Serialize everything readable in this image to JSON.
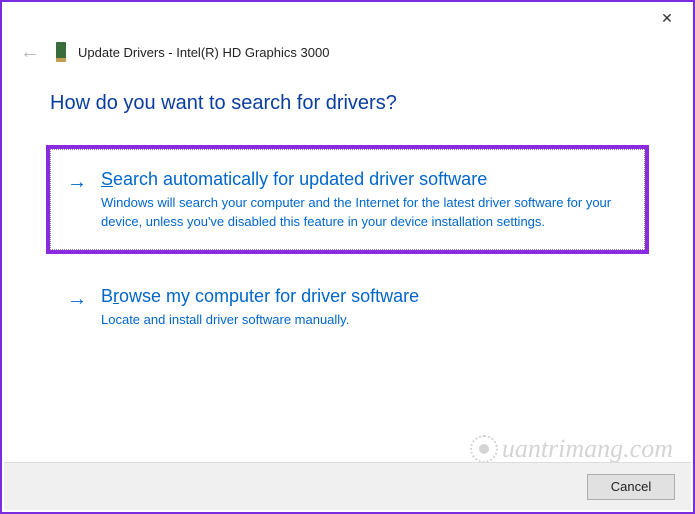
{
  "window": {
    "title": "Update Drivers - Intel(R) HD Graphics 3000"
  },
  "question": "How do you want to search for drivers?",
  "options": {
    "auto": {
      "title_prefix": "S",
      "title_rest": "earch automatically for updated driver software",
      "desc": "Windows will search your computer and the Internet for the latest driver software for your device, unless you've disabled this feature in your device installation settings."
    },
    "browse": {
      "title_prefix": "B",
      "title_underline": "r",
      "title_rest": "owse my computer for driver software",
      "desc": "Locate and install driver software manually."
    }
  },
  "buttons": {
    "cancel": "Cancel"
  },
  "watermark": "uantrimang.com"
}
